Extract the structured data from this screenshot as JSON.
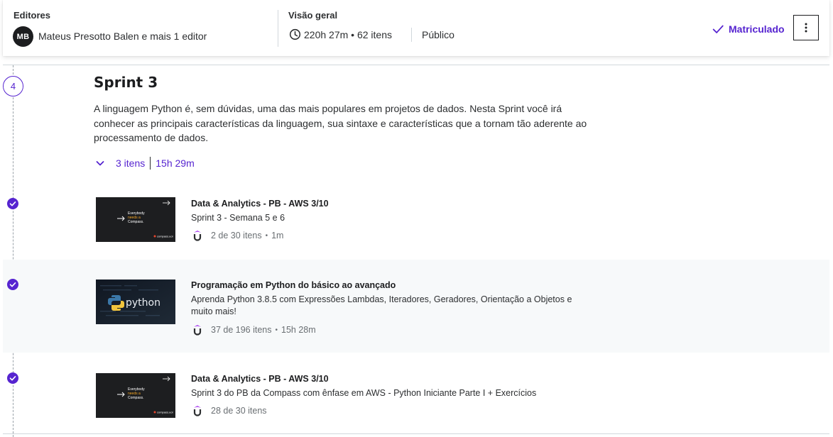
{
  "header": {
    "editors_label": "Editores",
    "avatar_initials": "MB",
    "editors_names": "Mateus Presotto Balen e mais 1 editor",
    "overview_label": "Visão geral",
    "duration_text": "220h 27m • 62 itens",
    "visibility": "Público",
    "enrolled_label": "Matriculado"
  },
  "sprint": {
    "step_number": "4",
    "title": "Sprint 3",
    "description": "A linguagem Python é, sem dúvidas, uma das mais populares em projetos de dados. Nesta Sprint você irá conhecer as principais características da linguagem, sua sintaxe e características que a tornam tão aderente ao processamento de dados.",
    "items_count": "3 itens",
    "total_duration": "15h 29m"
  },
  "items": [
    {
      "title": "Data & Analytics - PB - AWS 3/10",
      "subtitle": "Sprint 3 - Semana 5 e 6",
      "progress": "2 de 30 itens",
      "duration": "1m",
      "thumbnail_text": [
        "Everybody",
        "needs a",
        "Compass."
      ],
      "thumbnail_brand": "compass.uol"
    },
    {
      "title": "Programação em Python do básico ao avançado",
      "subtitle": "Aprenda Python 3.8.5 com Expressões Lambdas, Iteradores, Geradores, Orientação a Objetos e muito mais!",
      "progress": "37 de 196 itens",
      "duration": "15h 28m",
      "thumbnail_text": "python"
    },
    {
      "title": "Data & Analytics - PB - AWS 3/10",
      "subtitle": "Sprint 3 do PB da Compass com ênfase em AWS - Python Iniciante Parte I + Exercícios",
      "progress": "28 de 30 itens",
      "thumbnail_text": [
        "Everybody",
        "needs a",
        "Compass."
      ],
      "thumbnail_brand": "compass.uol"
    }
  ],
  "colors": {
    "accent": "#5624d0",
    "text": "#2d2f31",
    "highlight_bg": "#f7f9fa"
  }
}
